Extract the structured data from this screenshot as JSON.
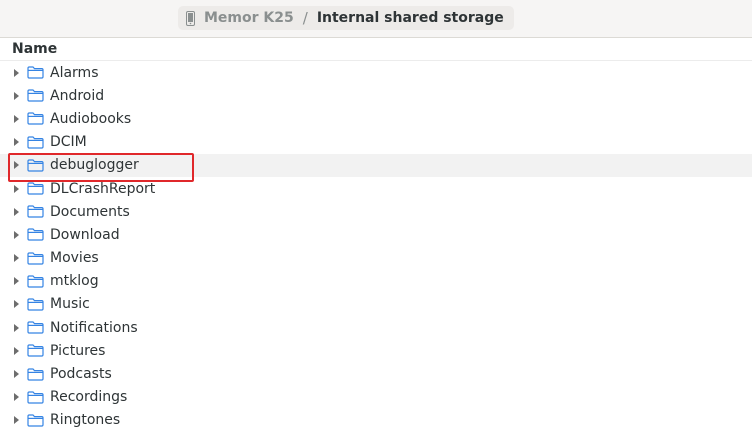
{
  "breadcrumb": {
    "device_icon": "phone-icon",
    "device": "Memor K25",
    "separator": "/",
    "location": "Internal shared storage"
  },
  "list": {
    "column_header": "Name",
    "folder_icon": "folder-icon",
    "hovered_item": "debuglogger",
    "items": [
      {
        "label": "Alarms"
      },
      {
        "label": "Android"
      },
      {
        "label": "Audiobooks"
      },
      {
        "label": "DCIM"
      },
      {
        "label": "debuglogger"
      },
      {
        "label": "DLCrashReport"
      },
      {
        "label": "Documents"
      },
      {
        "label": "Download"
      },
      {
        "label": "Movies"
      },
      {
        "label": "mtklog"
      },
      {
        "label": "Music"
      },
      {
        "label": "Notifications"
      },
      {
        "label": "Pictures"
      },
      {
        "label": "Podcasts"
      },
      {
        "label": "Recordings"
      },
      {
        "label": "Ringtones"
      }
    ]
  },
  "colors": {
    "accent": "#3584e4",
    "highlight_annotation": "#e0282b"
  }
}
